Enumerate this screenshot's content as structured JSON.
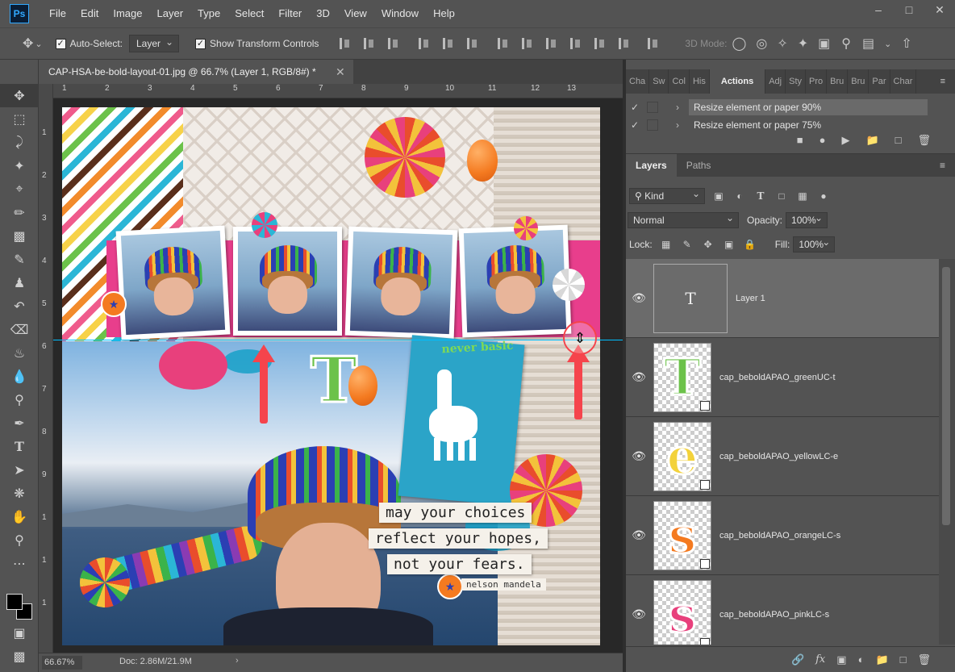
{
  "app": {
    "logo_text": "Ps",
    "menu": [
      "File",
      "Edit",
      "Image",
      "Layer",
      "Type",
      "Select",
      "Filter",
      "3D",
      "View",
      "Window",
      "Help"
    ]
  },
  "options_bar": {
    "auto_select_label": "Auto-Select:",
    "auto_select_checked": true,
    "auto_select_target": "Layer",
    "show_transform_label": "Show Transform Controls",
    "show_transform_checked": true,
    "mode3d_label": "3D Mode:"
  },
  "document": {
    "tab_title": "CAP-HSA-be-bold-layout-01.jpg @ 66.7% (Layer 1, RGB/8#) *",
    "zoom": "66.67%",
    "doc_info": "Doc: 2.86M/21.9M",
    "ruler_h": [
      "1",
      "2",
      "3",
      "4",
      "5",
      "6",
      "7",
      "8",
      "9",
      "10",
      "11",
      "12",
      "13"
    ],
    "ruler_v": [
      "1",
      "2",
      "3",
      "4",
      "5",
      "6",
      "7",
      "8",
      "9",
      "1",
      "1",
      "1"
    ]
  },
  "artwork": {
    "card_title": "never basic",
    "letter_T": "T",
    "quote_lines": [
      "may your choices",
      "reflect your hopes,",
      "not your fears."
    ],
    "quote_attribution": "nelson mandela"
  },
  "actions_panel": {
    "tabs": [
      "Cha",
      "Sw",
      "Col",
      "His",
      "Actions",
      "Adj",
      "Sty",
      "Pro",
      "Bru",
      "Bru",
      "Par",
      "Char"
    ],
    "active_tab": "Actions",
    "rows": [
      {
        "label": "Resize element or paper 90%",
        "checked": true
      },
      {
        "label": "Resize element or paper 75%",
        "checked": true
      }
    ]
  },
  "layers_panel": {
    "tabs": [
      "Layers",
      "Paths"
    ],
    "active_tab": "Layers",
    "filter_kind": "Kind",
    "blend_mode": "Normal",
    "opacity_label": "Opacity:",
    "opacity_value": "100%",
    "lock_label": "Lock:",
    "fill_label": "Fill:",
    "fill_value": "100%",
    "layers": [
      {
        "name": "Layer 1",
        "type": "text",
        "thumb": "T",
        "selected": true
      },
      {
        "name": "cap_beboldAPAO_greenUC-t",
        "type": "smart",
        "thumb": "T",
        "color": "#6cc24a"
      },
      {
        "name": "cap_beboldAPAO_yellowLC-e",
        "type": "smart",
        "thumb": "e",
        "color": "#f3d23b"
      },
      {
        "name": "cap_beboldAPAO_orangeLC-s",
        "type": "smart",
        "thumb": "s",
        "color": "#f47a20"
      },
      {
        "name": "cap_beboldAPAO_pinkLC-s",
        "type": "smart",
        "thumb": "s",
        "color": "#e8407c"
      }
    ]
  },
  "colors": {
    "accent": "#31a8ff",
    "annotation_red": "#f5444c",
    "guide": "#00bfff"
  }
}
